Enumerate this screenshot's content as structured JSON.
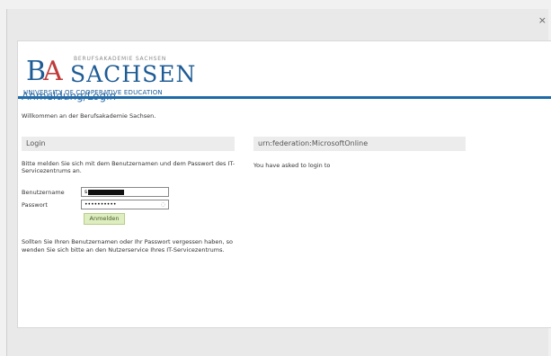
{
  "window": {
    "close_glyph": "×"
  },
  "logo": {
    "ba_b": "B",
    "ba_a": "A",
    "small_line": "BERUFSAKADEMIE SACHSEN",
    "big_line": "SACHSEN",
    "sub_line": "UNIVERSITY OF COOPERATIVE EDUCATION",
    "colors": {
      "blue": "#1e5c95",
      "red": "#c03a3a"
    }
  },
  "header": {
    "title": "Anmeldung/Login",
    "welcome": "Willkommen an der Berufsakademie Sachsen."
  },
  "login": {
    "heading": "Login",
    "info": "Bitte melden Sie sich mit dem Benutzernamen und dem Passwort des IT-Servicezentrums an.",
    "username_label": "Benutzername",
    "username_value": "s",
    "password_label": "Passwort",
    "password_value": "••••••••••",
    "submit_label": "Anmelden",
    "forgot_text": "Sollten Sie Ihren Benutzernamen oder Ihr Passwort vergessen haben, so wenden Sie sich bitte an den Nutzerservice Ihres IT-Servicezentrums."
  },
  "federation": {
    "heading": "urn:federation:MicrosoftOnline",
    "message": "You have asked to login to"
  },
  "icons": {
    "close": "close-icon",
    "password_reveal": "eye-icon"
  }
}
